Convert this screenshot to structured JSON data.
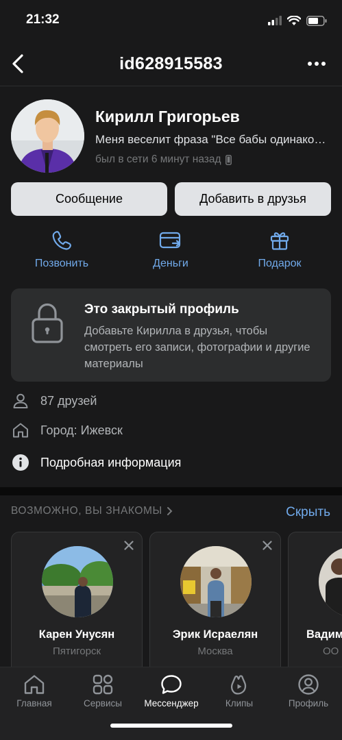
{
  "status_bar": {
    "time": "21:32"
  },
  "nav": {
    "title": "id628915583"
  },
  "profile": {
    "name": "Кирилл Григорьев",
    "status": "Меня веселит фраза \"Все бабы одинаковые\"",
    "online": "был в сети 6 минут назад"
  },
  "buttons": {
    "message": "Сообщение",
    "add_friend": "Добавить в друзья"
  },
  "actions": [
    {
      "label": "Позвонить",
      "icon": "phone-icon"
    },
    {
      "label": "Деньги",
      "icon": "money-card-icon"
    },
    {
      "label": "Подарок",
      "icon": "gift-icon"
    }
  ],
  "closed_profile": {
    "title": "Это закрытый профиль",
    "text": "Добавьте Кирилла в друзья, чтобы смотреть его записи, фотографии и другие материалы"
  },
  "info": {
    "friends": "87 друзей",
    "city": "Город: Ижевск",
    "details": "Подробная информация"
  },
  "suggestions": {
    "header": "ВОЗМОЖНО, ВЫ ЗНАКОМЫ",
    "hide": "Скрыть",
    "people": [
      {
        "name": "Карен Унусян",
        "city": "Пятигорск"
      },
      {
        "name": "Эрик Исраелян",
        "city": "Москва"
      },
      {
        "name": "Вадим",
        "city": "ОО"
      }
    ]
  },
  "tabbar": {
    "items": [
      {
        "label": "Главная",
        "icon": "home-icon"
      },
      {
        "label": "Сервисы",
        "icon": "services-icon"
      },
      {
        "label": "Мессенджер",
        "icon": "messenger-icon"
      },
      {
        "label": "Клипы",
        "icon": "clips-icon"
      },
      {
        "label": "Профиль",
        "icon": "profile-icon"
      }
    ],
    "active": "Мессенджер"
  },
  "colors": {
    "background": "#19191a",
    "accent": "#71aaeb",
    "card": "#2c2d2e"
  }
}
